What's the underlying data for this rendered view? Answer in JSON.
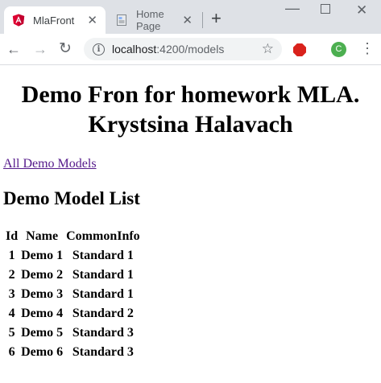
{
  "browser": {
    "tabs": [
      {
        "title": "MlaFront",
        "favicon": "angular-icon",
        "active": true
      },
      {
        "title": "Home Page",
        "favicon": "page-icon",
        "active": false
      }
    ],
    "new_tab_symbol": "+",
    "address": {
      "host": "localhost",
      "path": ":4200/models"
    },
    "profile_initial": "C",
    "accent_colors": {
      "angular": "#dd0031",
      "adblock": "#d9221c",
      "profile": "#4caf50",
      "visited_link": "#551a8b"
    }
  },
  "page": {
    "title_line1": "Demo Fron for homework MLA.",
    "title_line2": "Krystsina Halavach",
    "nav_link": "All Demo Models",
    "section_heading": "Demo Model List",
    "table": {
      "headers": [
        "Id",
        "Name",
        "CommonInfo"
      ],
      "rows": [
        [
          "1",
          "Demo 1",
          "Standard 1"
        ],
        [
          "2",
          "Demo 2",
          "Standard 1"
        ],
        [
          "3",
          "Demo 3",
          "Standard 1"
        ],
        [
          "4",
          "Demo 4",
          "Standard 2"
        ],
        [
          "5",
          "Demo 5",
          "Standard 3"
        ],
        [
          "6",
          "Demo 6",
          "Standard 3"
        ]
      ]
    }
  }
}
